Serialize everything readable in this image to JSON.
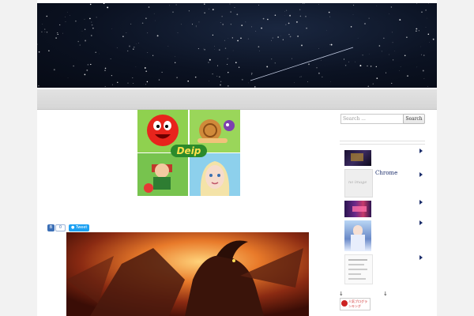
{
  "header": {
    "image": "starry-night-sky-with-shooting-star"
  },
  "ad": {
    "tiles": [
      {
        "icon": "red-ball-character-icon",
        "bg": "#8fd14f"
      },
      {
        "icon": "snail-character-icon",
        "bg": "#8fd14f"
      },
      {
        "icon": "cartoon-boy-character-icon",
        "bg": "#6fc24a"
      },
      {
        "icon": "princess-character-icon",
        "bg": "#7cc7e8"
      }
    ],
    "logo_text": "Deip"
  },
  "share": {
    "bookmark_count": "0",
    "tweet_label": "Tweet"
  },
  "article": {
    "image": "dragon-illustration"
  },
  "sidebar": {
    "search_placeholder": "Search ...",
    "search_button": "Search",
    "items": [
      {
        "thumb": "dark-game-thumbnail",
        "label": ""
      },
      {
        "thumb": "no-image-thumbnail",
        "thumb_text": "no image",
        "label": "Chrome"
      },
      {
        "thumb": "anime-banner-thumbnail",
        "label": ""
      },
      {
        "thumb": "anime-girl-thumbnail",
        "label": ""
      },
      {
        "thumb": "document-thumbnail",
        "label": ""
      }
    ],
    "ranking_banner": "人気ブログランキング",
    "colors": {
      "link": "#1b2d6b",
      "accent": "#cc2222"
    }
  }
}
